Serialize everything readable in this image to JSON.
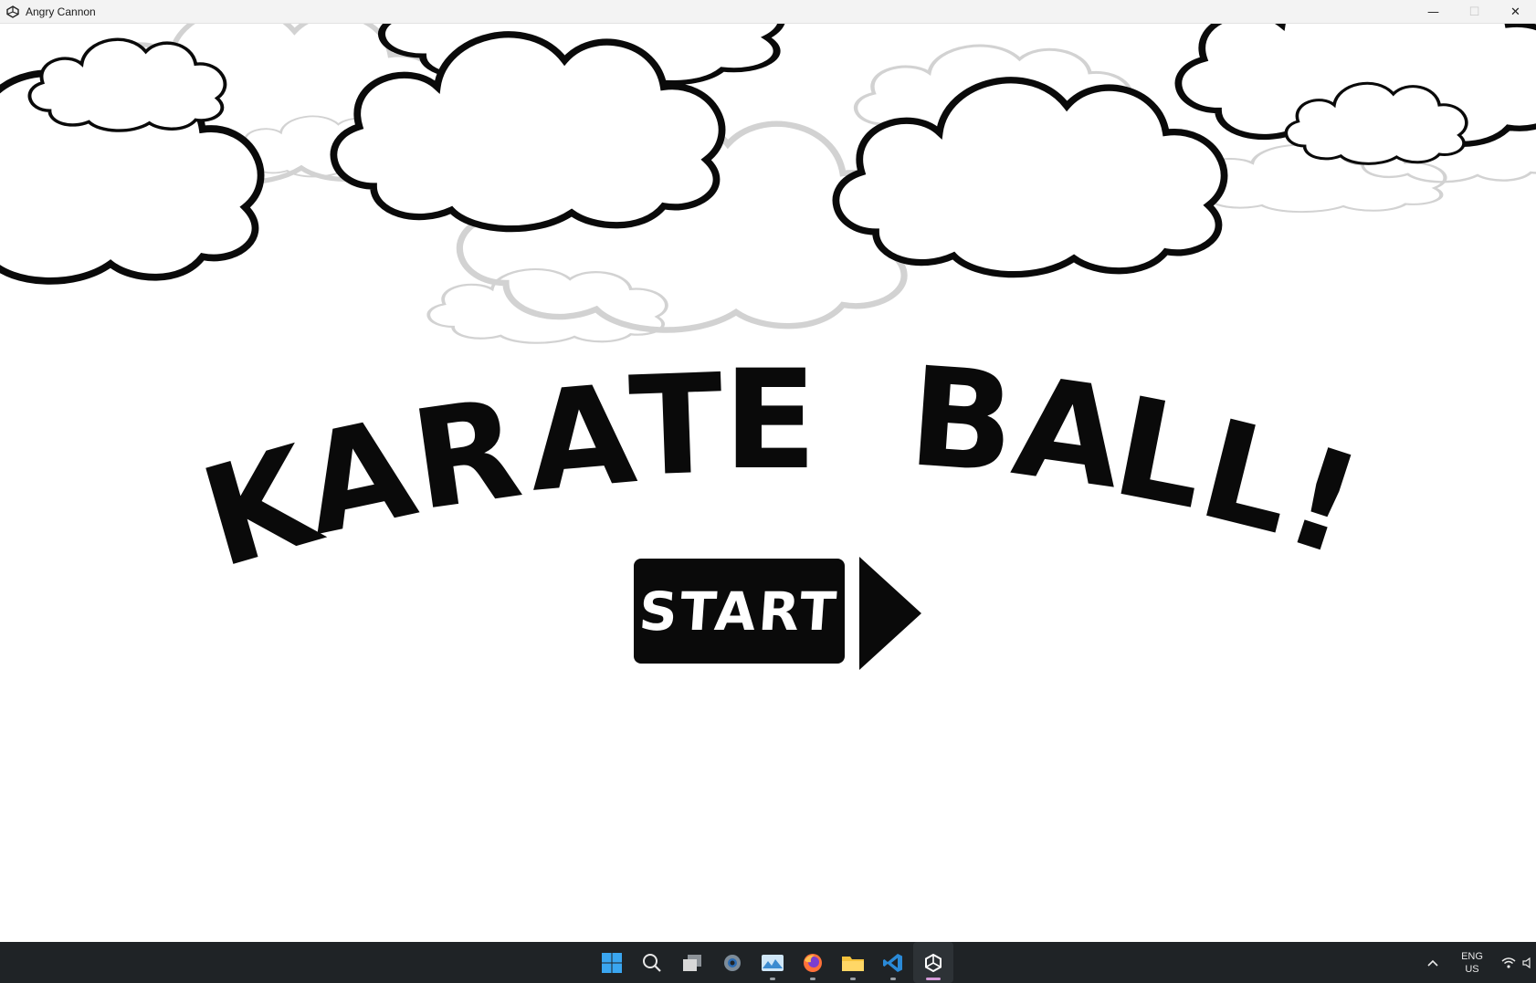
{
  "window": {
    "title": "Angry Cannon",
    "app_icon": "unity-icon",
    "controls": {
      "minimize": "—",
      "maximize": "☐",
      "close": "✕"
    }
  },
  "game": {
    "logo_letters": [
      "K",
      "A",
      "R",
      "A",
      "T",
      "E",
      "B",
      "A",
      "L",
      "L",
      "!"
    ],
    "start_label": "START",
    "colors": {
      "ink": "#0a0a0a",
      "background": "#ffffff",
      "faded_cloud": "#cfcfcf"
    }
  },
  "taskbar": {
    "apps": [
      {
        "name": "start-icon"
      },
      {
        "name": "search-icon"
      },
      {
        "name": "task-view-icon"
      },
      {
        "name": "settings-icon"
      },
      {
        "name": "photos-icon"
      },
      {
        "name": "firefox-icon"
      },
      {
        "name": "file-explorer-icon"
      },
      {
        "name": "vscode-icon"
      },
      {
        "name": "unity-app-icon"
      }
    ],
    "tray": {
      "lang_line1": "ENG",
      "lang_line2": "US"
    }
  }
}
